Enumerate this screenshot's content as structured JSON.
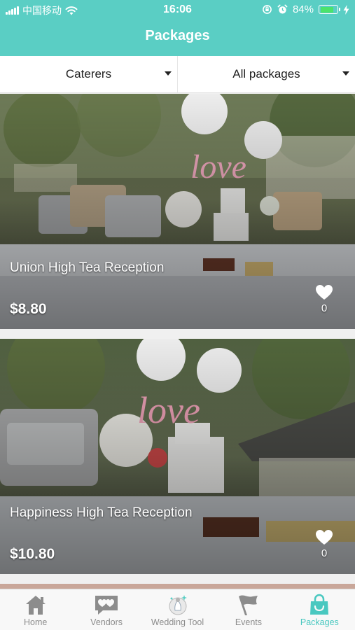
{
  "status_bar": {
    "carrier": "中国移动",
    "time": "16:06",
    "battery_label": "84%",
    "battery_level": 0.84
  },
  "header": {
    "title": "Packages"
  },
  "filters": {
    "caterers": "Caterers",
    "packages": "All packages"
  },
  "cards": [
    {
      "title": "Union High Tea Reception",
      "price": "$8.80",
      "likes": "0"
    },
    {
      "title": "Happiness High Tea Reception",
      "price": "$10.80",
      "likes": "0"
    }
  ],
  "tabbar": {
    "items": [
      {
        "label": "Home",
        "icon": "house-icon"
      },
      {
        "label": "Vendors",
        "icon": "vendors-hearts-icon"
      },
      {
        "label": "Wedding Tool",
        "icon": "wedding-tool-icon"
      },
      {
        "label": "Events",
        "icon": "flag-icon"
      },
      {
        "label": "Packages",
        "icon": "shopping-bag-icon"
      }
    ],
    "active": "Packages"
  },
  "colors": {
    "brand": "#5acec4",
    "tab_active": "#49c8c0",
    "tab_inactive": "#8c8c8c",
    "battery": "#4be36b"
  }
}
